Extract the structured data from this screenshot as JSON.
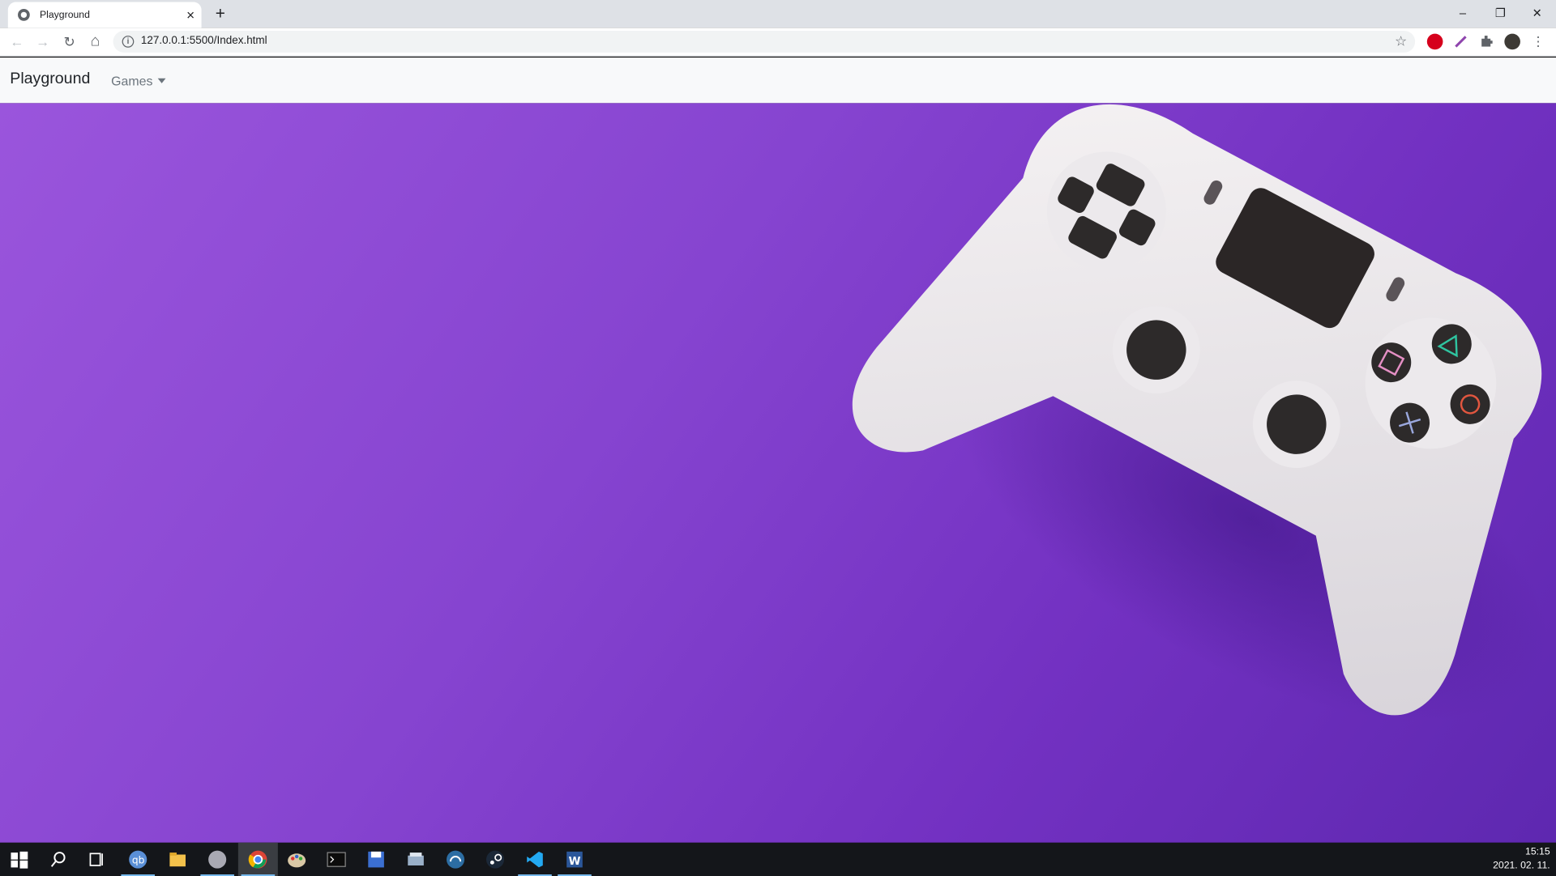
{
  "browser": {
    "tab_title": "Playground",
    "tab_close": "×",
    "new_tab": "+",
    "url": "127.0.0.1:5500/Index.html",
    "window_controls": {
      "minimize": "–",
      "restore": "❐",
      "close": "✕"
    },
    "nav": {
      "back": "←",
      "forward": "→",
      "reload": "↻",
      "home": "⌂"
    },
    "star": "☆",
    "extensions": [
      {
        "name": "adblock-plus-icon",
        "color": "#d6001c"
      },
      {
        "name": "pen-extension-icon",
        "color": "#8e44ad"
      },
      {
        "name": "puzzle-extensions-icon",
        "color": "#5f6368"
      },
      {
        "name": "profile-avatar-icon",
        "color": "#3d3a35"
      }
    ],
    "menu": "⋮"
  },
  "page": {
    "navbar": {
      "brand": "Playground",
      "dropdown_label": "Games"
    },
    "hero": {
      "background_colors": [
        "#9a55dc",
        "#8644d0",
        "#7331c2",
        "#5e28b0"
      ],
      "image": "white-game-controller-on-purple"
    }
  },
  "taskbar": {
    "icons": [
      "windows-start-icon",
      "search-icon",
      "task-view-icon",
      "qbittorrent-icon",
      "file-explorer-icon",
      "app-icon",
      "chrome-icon",
      "paint-icon",
      "terminal-icon",
      "save-disk-icon",
      "scanner-icon",
      "headset-icon",
      "steam-icon",
      "vscode-icon",
      "word-icon"
    ],
    "time": "15:15",
    "date": "2021. 02. 11."
  }
}
